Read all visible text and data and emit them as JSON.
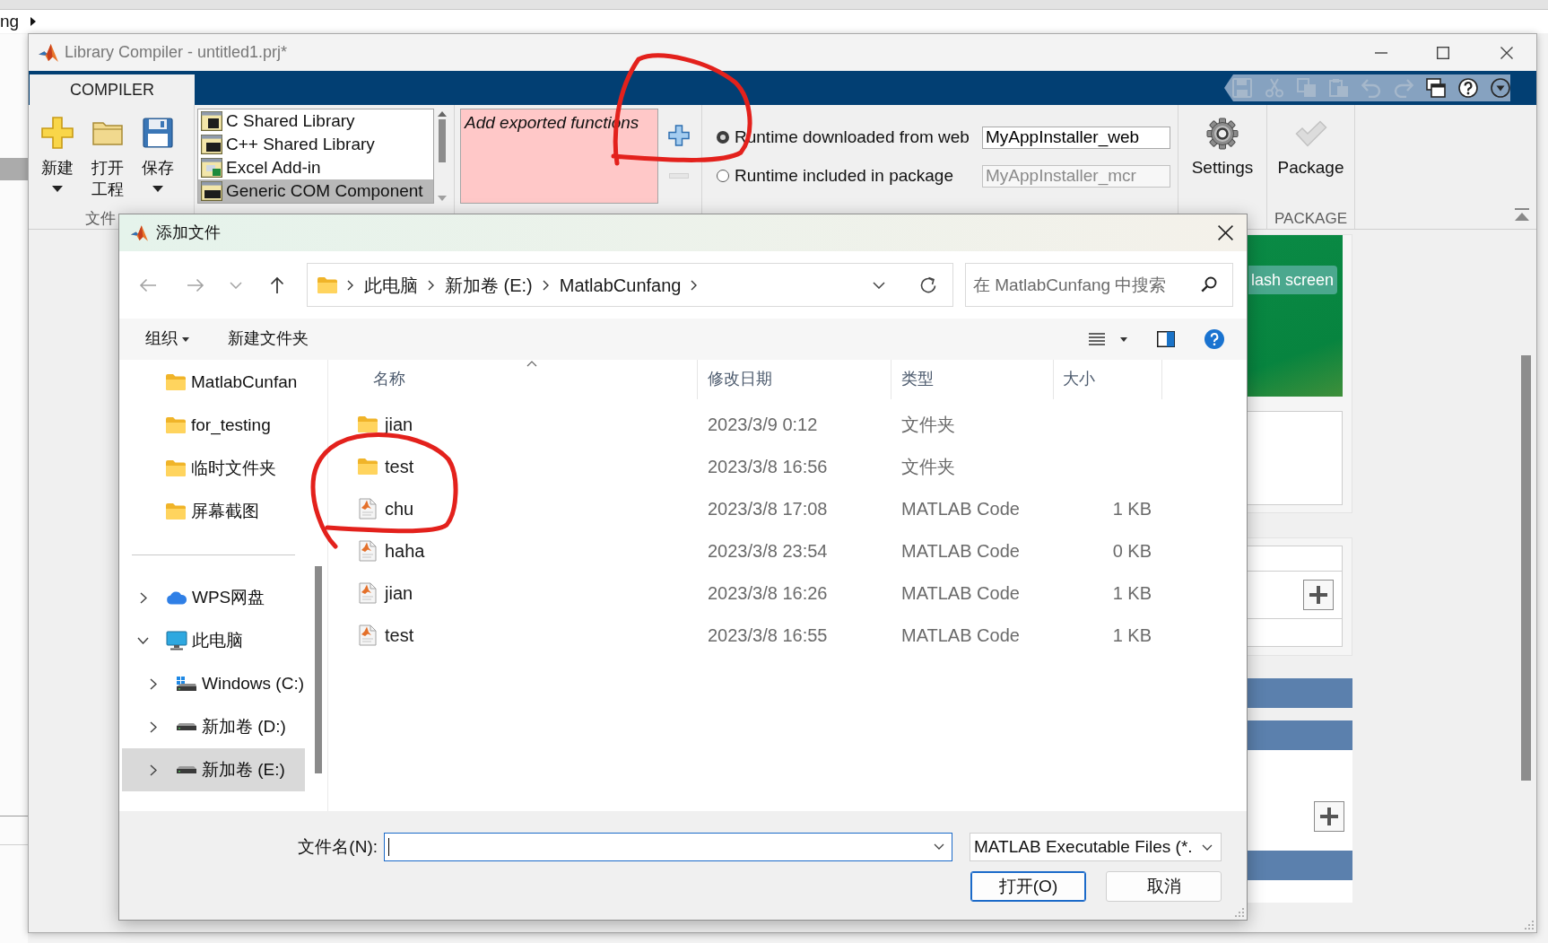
{
  "background": {
    "breadcrumb": "ng"
  },
  "window": {
    "title": "Library Compiler - untitled1.prj*"
  },
  "ribbon": {
    "tabs": [
      {
        "label": "COMPILER",
        "selected": true
      }
    ],
    "quick_access": [
      {
        "kind": "save",
        "disabled": true
      },
      {
        "kind": "cut",
        "disabled": true
      },
      {
        "kind": "copy",
        "disabled": true
      },
      {
        "kind": "paste",
        "disabled": true
      },
      {
        "kind": "undo",
        "disabled": true
      },
      {
        "kind": "redo",
        "disabled": true
      },
      {
        "kind": "layout",
        "disabled": false
      },
      {
        "kind": "help",
        "disabled": false
      },
      {
        "kind": "more",
        "disabled": false
      }
    ],
    "file_section": {
      "label": "文件",
      "buttons": [
        {
          "kind": "new",
          "label": "新建",
          "menu": true
        },
        {
          "kind": "open",
          "label": "打开工程",
          "menu": false
        },
        {
          "kind": "save",
          "label": "保存",
          "menu": true
        }
      ]
    },
    "type_list": {
      "items": [
        {
          "kind": "c",
          "label": "C Shared Library",
          "selected": false
        },
        {
          "kind": "cpp",
          "label": "C++ Shared Library",
          "selected": false
        },
        {
          "kind": "excel",
          "label": "Excel Add-in",
          "selected": false
        },
        {
          "kind": "com",
          "label": "Generic COM Component",
          "selected": true
        }
      ]
    },
    "exported_functions": {
      "empty_text": "Add exported functions"
    },
    "packaging_options": [
      {
        "label": "Runtime downloaded from web",
        "selected": true,
        "value": "MyAppInstaller_web",
        "disabled": false
      },
      {
        "label": "Runtime included in package",
        "selected": false,
        "value": "MyAppInstaller_mcr",
        "disabled": true
      }
    ],
    "settings": {
      "label": "Settings"
    },
    "package": {
      "label": "Package",
      "section_label": "PACKAGE"
    }
  },
  "side_panel": {
    "splash_label": "lash screen"
  },
  "dialog": {
    "title": "添加文件",
    "nav_buttons": [
      {
        "kind": "back",
        "disabled": true
      },
      {
        "kind": "forward",
        "disabled": true
      },
      {
        "kind": "recent",
        "disabled": true
      },
      {
        "kind": "up",
        "disabled": false
      }
    ],
    "address": [
      "此电脑",
      "新加卷 (E:)",
      "MatlabCunfang"
    ],
    "search": {
      "placeholder": "在 MatlabCunfang 中搜索"
    },
    "toolbar": {
      "organize": "组织",
      "new_folder": "新建文件夹"
    },
    "nav_pane": {
      "pinned": [
        "MatlabCunfan",
        "for_testing",
        "临时文件夹",
        "屏幕截图"
      ],
      "tree": [
        {
          "kind": "cloud",
          "label": "WPS网盘",
          "expanded": false,
          "selected": false
        },
        {
          "kind": "computer",
          "label": "此电脑",
          "expanded": true,
          "selected": false,
          "children": [
            {
              "kind": "system-drive",
              "label": "Windows (C:)",
              "expanded": false,
              "selected": false
            },
            {
              "kind": "drive",
              "label": "新加卷 (D:)",
              "expanded": false,
              "selected": false
            },
            {
              "kind": "drive",
              "label": "新加卷 (E:)",
              "expanded": false,
              "selected": true
            }
          ]
        }
      ]
    },
    "file_list": {
      "columns": [
        {
          "label": "名称",
          "sorted": true
        },
        {
          "label": "修改日期",
          "sorted": false
        },
        {
          "label": "类型",
          "sorted": false
        },
        {
          "label": "大小",
          "sorted": false
        }
      ],
      "rows": [
        {
          "kind": "folder",
          "name": "jian",
          "date": "2023/3/9 0:12",
          "type": "文件夹"
        },
        {
          "kind": "folder",
          "name": "test",
          "date": "2023/3/8 16:56",
          "type": "文件夹"
        },
        {
          "kind": "code",
          "name": "chu",
          "date": "2023/3/8 17:08",
          "type": "MATLAB Code",
          "size": "1 KB"
        },
        {
          "kind": "code",
          "name": "haha",
          "date": "2023/3/8 23:54",
          "type": "MATLAB Code",
          "size": "0 KB"
        },
        {
          "kind": "code",
          "name": "jian",
          "date": "2023/3/8 16:26",
          "type": "MATLAB Code",
          "size": "1 KB"
        },
        {
          "kind": "code",
          "name": "test",
          "date": "2023/3/8 16:55",
          "type": "MATLAB Code",
          "size": "1 KB"
        }
      ]
    },
    "filename": {
      "label": "文件名(N):"
    },
    "filter": {
      "value": "MATLAB Executable Files (*."
    },
    "buttons": [
      {
        "label": "打开(O)",
        "default": true
      },
      {
        "label": "取消",
        "default": false
      }
    ]
  }
}
